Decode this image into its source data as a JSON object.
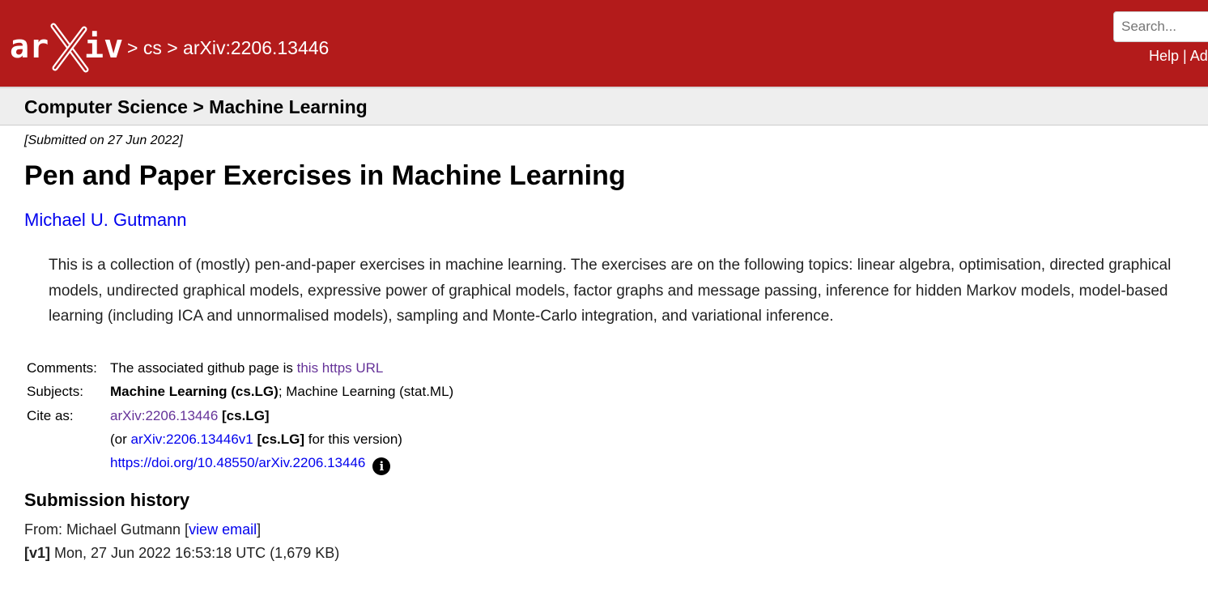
{
  "header": {
    "logo_text": "arXiv",
    "breadcrumb": {
      "sep1": ">",
      "category": "cs",
      "sep2": ">",
      "paper_id": "arXiv:2206.13446"
    },
    "search_placeholder": "Search...",
    "links": {
      "help": "Help",
      "sep": "|",
      "advanced": "Ad"
    }
  },
  "subheader": {
    "title": "Computer Science > Machine Learning"
  },
  "paper": {
    "dateline": "[Submitted on 27 Jun 2022]",
    "title": "Pen and Paper Exercises in Machine Learning",
    "author": "Michael U. Gutmann",
    "abstract": "This is a collection of (mostly) pen-and-paper exercises in machine learning. The exercises are on the following topics: linear algebra, optimisation, directed graphical models, undirected graphical models, expressive power of graphical models, factor graphs and message passing, inference for hidden Markov models, model-based learning (including ICA and unnormalised models), sampling and Monte-Carlo integration, and variational inference."
  },
  "metadata": {
    "comments_label": "Comments:",
    "comments_text": "The associated github page is ",
    "comments_link": "this https URL",
    "subjects_label": "Subjects:",
    "subjects_primary": "Machine Learning (cs.LG)",
    "subjects_rest": "; Machine Learning (stat.ML)",
    "cite_label": "Cite as:",
    "cite_id": "arXiv:2206.13446",
    "cite_tag": "[cs.LG]",
    "cite_version_prefix": "(or ",
    "cite_version_id": "arXiv:2206.13446v1",
    "cite_version_tag": "[cs.LG]",
    "cite_version_suffix": " for this version)",
    "doi": "https://doi.org/10.48550/arXiv.2206.13446",
    "info_icon": "info-icon"
  },
  "history": {
    "title": "Submission history",
    "from_prefix": "From: Michael Gutmann [",
    "view_email": "view email",
    "from_suffix": "]",
    "v1_tag": "[v1]",
    "v1_text": " Mon, 27 Jun 2022 16:53:18 UTC (1,679 KB)"
  },
  "colors": {
    "brand_red": "#b31b1b",
    "link": "#0000ee",
    "visited": "#663399",
    "subheader_bg": "#eeeeee"
  }
}
